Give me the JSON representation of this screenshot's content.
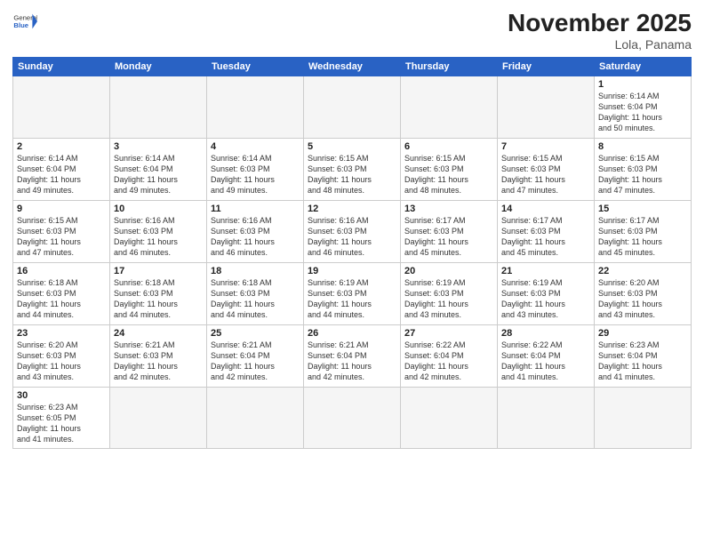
{
  "header": {
    "logo_general": "General",
    "logo_blue": "Blue",
    "month": "November 2025",
    "location": "Lola, Panama"
  },
  "weekdays": [
    "Sunday",
    "Monday",
    "Tuesday",
    "Wednesday",
    "Thursday",
    "Friday",
    "Saturday"
  ],
  "weeks": [
    [
      {
        "day": "",
        "info": ""
      },
      {
        "day": "",
        "info": ""
      },
      {
        "day": "",
        "info": ""
      },
      {
        "day": "",
        "info": ""
      },
      {
        "day": "",
        "info": ""
      },
      {
        "day": "",
        "info": ""
      },
      {
        "day": "1",
        "info": "Sunrise: 6:14 AM\nSunset: 6:04 PM\nDaylight: 11 hours\nand 50 minutes."
      }
    ],
    [
      {
        "day": "2",
        "info": "Sunrise: 6:14 AM\nSunset: 6:04 PM\nDaylight: 11 hours\nand 49 minutes."
      },
      {
        "day": "3",
        "info": "Sunrise: 6:14 AM\nSunset: 6:04 PM\nDaylight: 11 hours\nand 49 minutes."
      },
      {
        "day": "4",
        "info": "Sunrise: 6:14 AM\nSunset: 6:03 PM\nDaylight: 11 hours\nand 49 minutes."
      },
      {
        "day": "5",
        "info": "Sunrise: 6:15 AM\nSunset: 6:03 PM\nDaylight: 11 hours\nand 48 minutes."
      },
      {
        "day": "6",
        "info": "Sunrise: 6:15 AM\nSunset: 6:03 PM\nDaylight: 11 hours\nand 48 minutes."
      },
      {
        "day": "7",
        "info": "Sunrise: 6:15 AM\nSunset: 6:03 PM\nDaylight: 11 hours\nand 47 minutes."
      },
      {
        "day": "8",
        "info": "Sunrise: 6:15 AM\nSunset: 6:03 PM\nDaylight: 11 hours\nand 47 minutes."
      }
    ],
    [
      {
        "day": "9",
        "info": "Sunrise: 6:15 AM\nSunset: 6:03 PM\nDaylight: 11 hours\nand 47 minutes."
      },
      {
        "day": "10",
        "info": "Sunrise: 6:16 AM\nSunset: 6:03 PM\nDaylight: 11 hours\nand 46 minutes."
      },
      {
        "day": "11",
        "info": "Sunrise: 6:16 AM\nSunset: 6:03 PM\nDaylight: 11 hours\nand 46 minutes."
      },
      {
        "day": "12",
        "info": "Sunrise: 6:16 AM\nSunset: 6:03 PM\nDaylight: 11 hours\nand 46 minutes."
      },
      {
        "day": "13",
        "info": "Sunrise: 6:17 AM\nSunset: 6:03 PM\nDaylight: 11 hours\nand 45 minutes."
      },
      {
        "day": "14",
        "info": "Sunrise: 6:17 AM\nSunset: 6:03 PM\nDaylight: 11 hours\nand 45 minutes."
      },
      {
        "day": "15",
        "info": "Sunrise: 6:17 AM\nSunset: 6:03 PM\nDaylight: 11 hours\nand 45 minutes."
      }
    ],
    [
      {
        "day": "16",
        "info": "Sunrise: 6:18 AM\nSunset: 6:03 PM\nDaylight: 11 hours\nand 44 minutes."
      },
      {
        "day": "17",
        "info": "Sunrise: 6:18 AM\nSunset: 6:03 PM\nDaylight: 11 hours\nand 44 minutes."
      },
      {
        "day": "18",
        "info": "Sunrise: 6:18 AM\nSunset: 6:03 PM\nDaylight: 11 hours\nand 44 minutes."
      },
      {
        "day": "19",
        "info": "Sunrise: 6:19 AM\nSunset: 6:03 PM\nDaylight: 11 hours\nand 44 minutes."
      },
      {
        "day": "20",
        "info": "Sunrise: 6:19 AM\nSunset: 6:03 PM\nDaylight: 11 hours\nand 43 minutes."
      },
      {
        "day": "21",
        "info": "Sunrise: 6:19 AM\nSunset: 6:03 PM\nDaylight: 11 hours\nand 43 minutes."
      },
      {
        "day": "22",
        "info": "Sunrise: 6:20 AM\nSunset: 6:03 PM\nDaylight: 11 hours\nand 43 minutes."
      }
    ],
    [
      {
        "day": "23",
        "info": "Sunrise: 6:20 AM\nSunset: 6:03 PM\nDaylight: 11 hours\nand 43 minutes."
      },
      {
        "day": "24",
        "info": "Sunrise: 6:21 AM\nSunset: 6:03 PM\nDaylight: 11 hours\nand 42 minutes."
      },
      {
        "day": "25",
        "info": "Sunrise: 6:21 AM\nSunset: 6:04 PM\nDaylight: 11 hours\nand 42 minutes."
      },
      {
        "day": "26",
        "info": "Sunrise: 6:21 AM\nSunset: 6:04 PM\nDaylight: 11 hours\nand 42 minutes."
      },
      {
        "day": "27",
        "info": "Sunrise: 6:22 AM\nSunset: 6:04 PM\nDaylight: 11 hours\nand 42 minutes."
      },
      {
        "day": "28",
        "info": "Sunrise: 6:22 AM\nSunset: 6:04 PM\nDaylight: 11 hours\nand 41 minutes."
      },
      {
        "day": "29",
        "info": "Sunrise: 6:23 AM\nSunset: 6:04 PM\nDaylight: 11 hours\nand 41 minutes."
      }
    ],
    [
      {
        "day": "30",
        "info": "Sunrise: 6:23 AM\nSunset: 6:05 PM\nDaylight: 11 hours\nand 41 minutes."
      },
      {
        "day": "",
        "info": ""
      },
      {
        "day": "",
        "info": ""
      },
      {
        "day": "",
        "info": ""
      },
      {
        "day": "",
        "info": ""
      },
      {
        "day": "",
        "info": ""
      },
      {
        "day": "",
        "info": ""
      }
    ]
  ]
}
